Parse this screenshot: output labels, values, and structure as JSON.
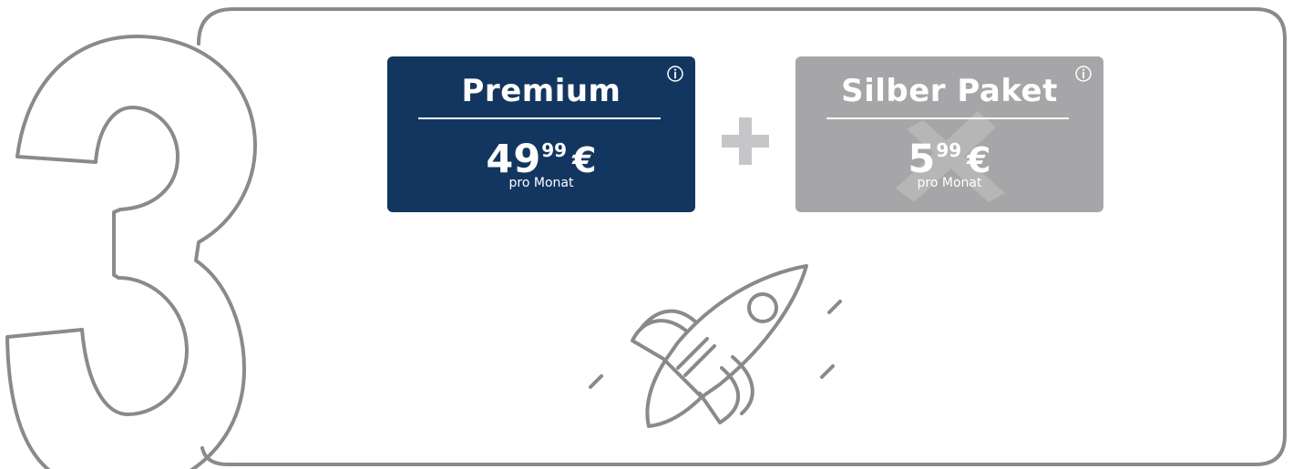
{
  "step": {
    "number": "3",
    "number_icon": "outline-digit-three-icon"
  },
  "plans": [
    {
      "name": "Premium",
      "price_main": "49",
      "price_cents": "99",
      "currency": "€",
      "period": "pro Monat",
      "info_icon": "info-icon",
      "color": "#133660"
    },
    {
      "name": "Silber Paket",
      "price_main": "5",
      "price_cents": "99",
      "currency": "€",
      "period": "pro Monat",
      "info_icon": "info-icon",
      "color": "#a6a6a8"
    }
  ],
  "combinator_icon": "plus-icon",
  "illustration_icon": "rocket-icon",
  "colors": {
    "outline": "#8a8a8a",
    "plus": "#c6c6c8"
  }
}
